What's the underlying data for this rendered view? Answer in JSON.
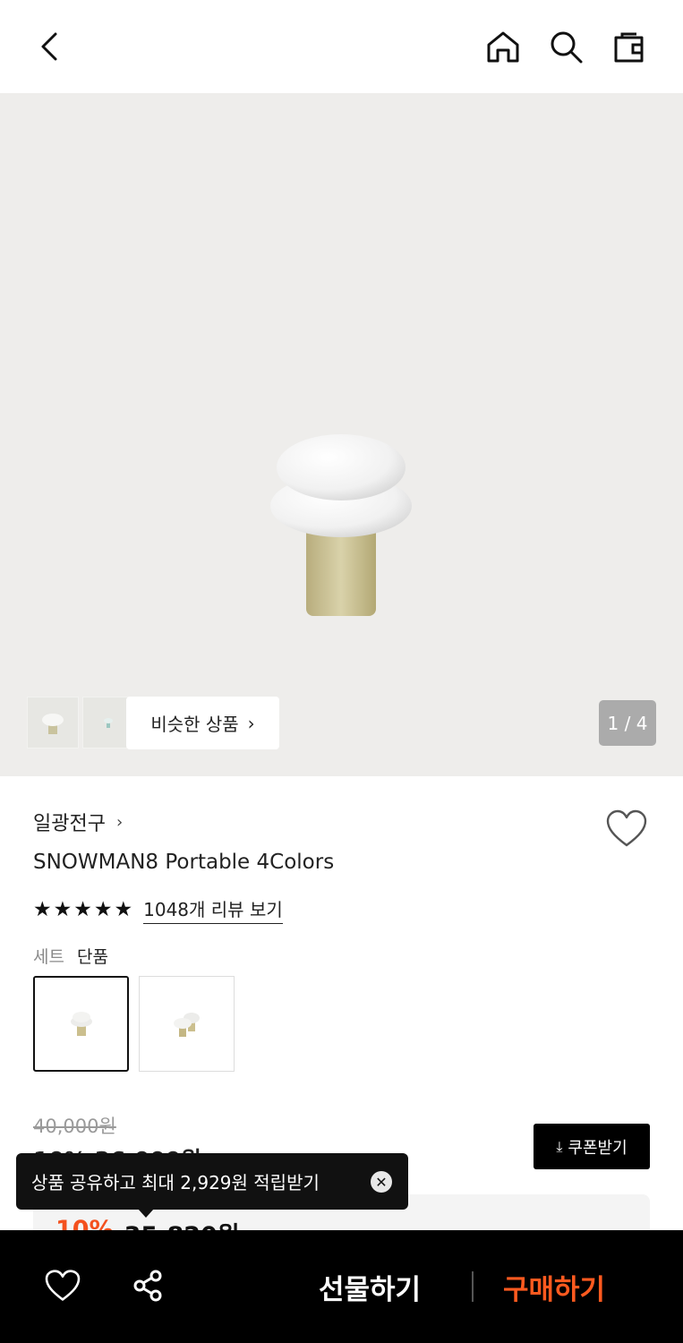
{
  "header": {
    "back_icon": "chevron-left-icon",
    "home_icon": "home-icon",
    "search_icon": "search-icon",
    "bag_icon": "shopping-bag-icon"
  },
  "gallery": {
    "similar_label": "비슷한 상품",
    "counter": "1 / 4",
    "background": "#eeedeb"
  },
  "product": {
    "brand": "일광전구",
    "title": "SNOWMAN8 Portable 4Colors",
    "rating": 5,
    "review_link": "1048개 리뷰 보기",
    "option_labels": [
      "세트",
      "단품"
    ]
  },
  "price": {
    "original": "40,000원",
    "hidden": "10% 36,000원",
    "coupon_button": "쿠폰받기",
    "final_discount": "10%",
    "final_amount": "35,820원",
    "accent": "#f4511e"
  },
  "tooltip": {
    "text": "상품 공유하고 최대 2,929원 적립받기"
  },
  "bottom_bar": {
    "gift_label": "선물하기",
    "buy_label": "구매하기",
    "buy_color": "#ff5a1f"
  }
}
